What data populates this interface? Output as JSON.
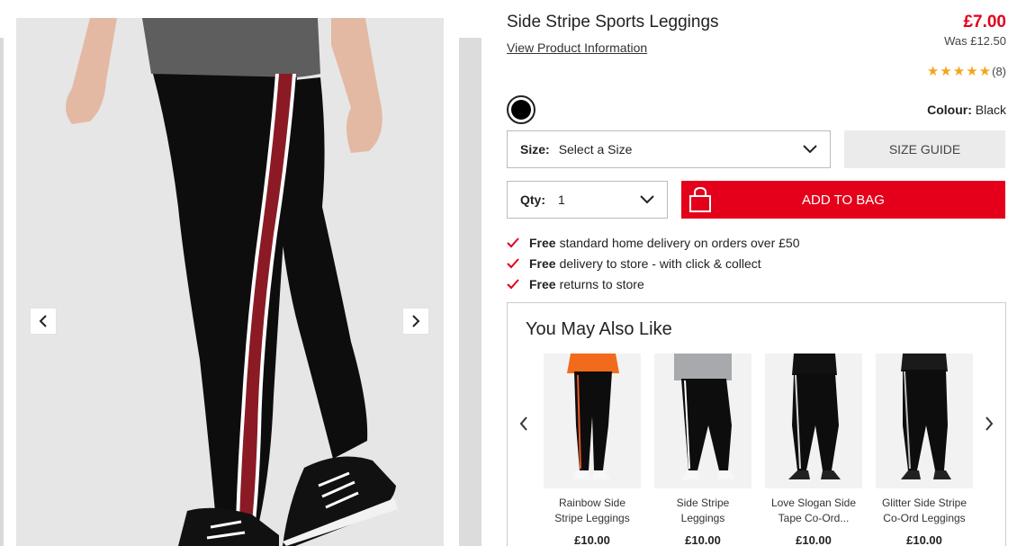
{
  "product": {
    "title": "Side Stripe Sports Leggings",
    "view_info": "View Product Information",
    "price": "£7.00",
    "was_price": "Was £12.50",
    "rating_count": "(8)",
    "stars": 5,
    "colour_label": "Colour:",
    "colour_value": "Black",
    "swatch_color": "#000000",
    "accent_color": "#e4001b"
  },
  "size": {
    "label": "Size:",
    "value": "Select a Size"
  },
  "size_guide": "SIZE GUIDE",
  "qty": {
    "label": "Qty:",
    "value": "1"
  },
  "add_to_bag": "ADD TO BAG",
  "benefits": [
    {
      "bold": "Free",
      "text": "standard home delivery on orders over £50"
    },
    {
      "bold": "Free",
      "text": "delivery to store - with click & collect"
    },
    {
      "bold": "Free",
      "text": "returns to store"
    }
  ],
  "recommendations": {
    "title": "You May Also Like",
    "items": [
      {
        "name": "Rainbow Side Stripe Leggings",
        "price": "£10.00",
        "top_color": "#f26a1b",
        "stripe_color": "#e8572a"
      },
      {
        "name": "Side Stripe Leggings",
        "price": "£10.00",
        "top_color": "#a7a9ac",
        "stripe_color": "#ffffff"
      },
      {
        "name": "Love Slogan Side Tape Co-Ord...",
        "price": "£10.00",
        "top_color": "#111111",
        "stripe_color": "#d8d8d8"
      },
      {
        "name": "Glitter Side Stripe Co-Ord Leggings",
        "price": "£10.00",
        "top_color": "#1a1a1a",
        "stripe_color": "#bfbfbf"
      }
    ]
  },
  "icons": {
    "gallery_prev": "chevron-left-icon",
    "gallery_next": "chevron-right-icon",
    "dropdown": "chevron-down-icon",
    "bag": "shopping-bag-icon",
    "tick": "checkmark-icon"
  }
}
